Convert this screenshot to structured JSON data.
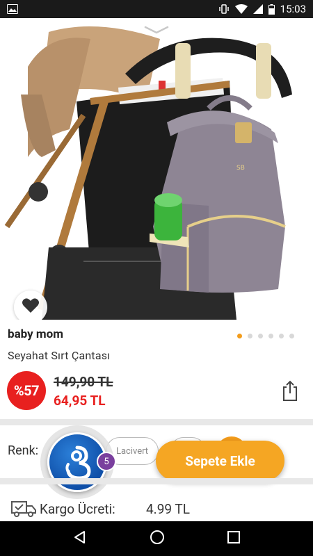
{
  "status_bar": {
    "time": "15:03"
  },
  "product": {
    "brand": "baby mom",
    "name": "Seyahat Sırt Çantası",
    "discount": "%57",
    "old_price": "149,90 TL",
    "new_price": "64,95 TL",
    "image_pages": 6,
    "active_page": 1
  },
  "options": {
    "color_label": "Renk:",
    "chips": [
      "Lacivert"
    ]
  },
  "brand_bubble": {
    "count": "5"
  },
  "actions": {
    "add_to_cart": "Sepete Ekle"
  },
  "shipping": {
    "label": "Kargo Ücreti:",
    "value": "4.99 TL"
  },
  "colors": {
    "accent": "#f5a623",
    "discount": "#e8201f",
    "bubble_badge": "#7a3f9e"
  }
}
